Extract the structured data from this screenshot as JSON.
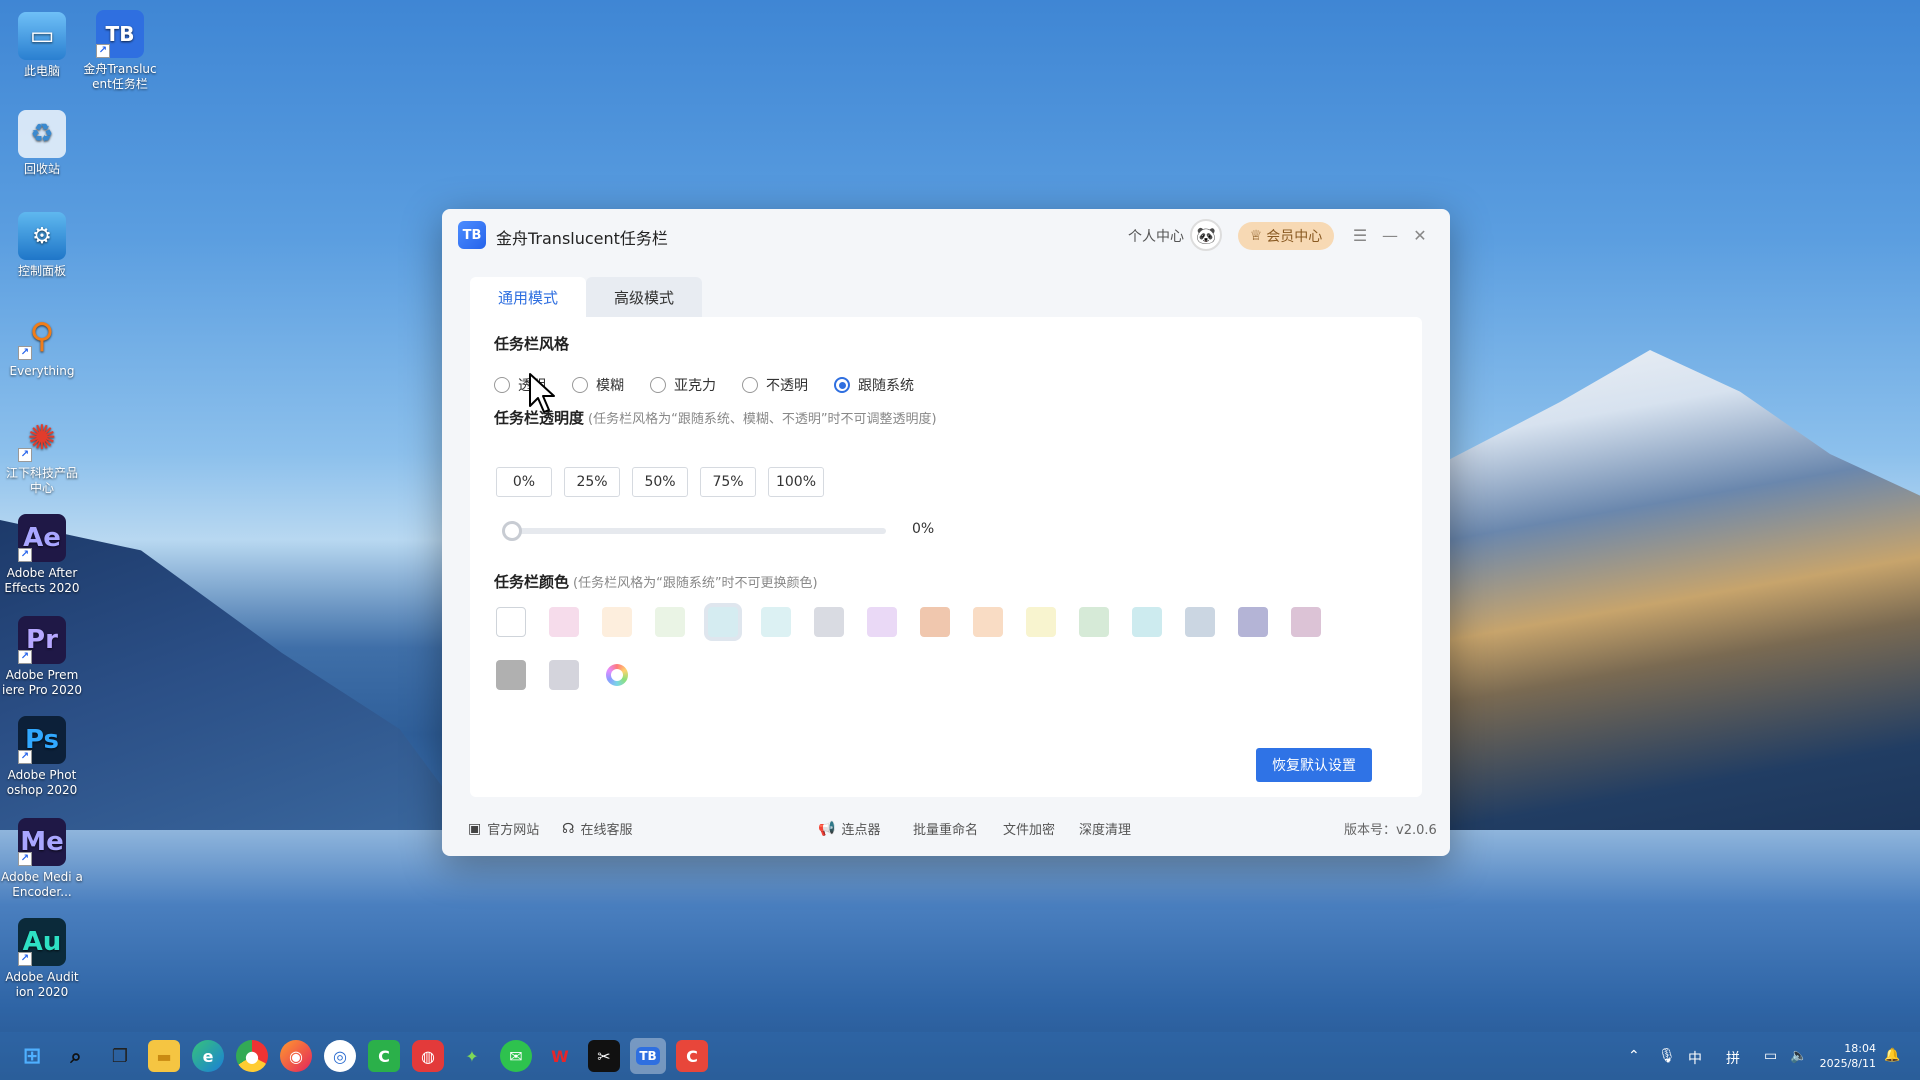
{
  "desktop": {
    "icons": [
      {
        "label": "此电脑",
        "icon": "computer-icon",
        "color": "#3b8fd8"
      },
      {
        "label": "金舟Transluc ent任务栏",
        "icon": "tb-app-icon",
        "color": "#2f6fe0"
      },
      {
        "label": "回收站",
        "icon": "recycle-bin-icon",
        "color": "#d9e6f2"
      },
      {
        "label": "控制面板",
        "icon": "control-panel-icon",
        "color": "#2e8fd8"
      },
      {
        "label": "Everything",
        "icon": "everything-search-icon",
        "color": "#f07d1a"
      },
      {
        "label": "江下科技产品 中心",
        "icon": "product-center-icon",
        "color": "#e23c2c"
      },
      {
        "label": "Adobe After Effects 2020",
        "glyph": "Ae",
        "icon": "after-effects-icon",
        "color": "#1f1846"
      },
      {
        "label": "Adobe Prem iere Pro 2020",
        "glyph": "Pr",
        "icon": "premiere-icon",
        "color": "#1f1846"
      },
      {
        "label": "Adobe Phot oshop 2020",
        "glyph": "Ps",
        "icon": "photoshop-icon",
        "color": "#0c2039"
      },
      {
        "label": "Adobe Medi a Encoder...",
        "glyph": "Me",
        "icon": "media-encoder-icon",
        "color": "#1f1846"
      },
      {
        "label": "Adobe Audit ion 2020",
        "glyph": "Au",
        "icon": "audition-icon",
        "color": "#0b2a3a"
      }
    ]
  },
  "window": {
    "logo_text": "TB",
    "title": "金舟Translucent任务栏",
    "personal_center": "个人中心",
    "vip_center": "会员中心",
    "tabs": [
      {
        "label": "通用模式",
        "active": true
      },
      {
        "label": "高级模式",
        "active": false
      }
    ],
    "style_section": {
      "title": "任务栏风格",
      "options": [
        {
          "label": "透明",
          "selected": false
        },
        {
          "label": "模糊",
          "selected": false
        },
        {
          "label": "亚克力",
          "selected": false
        },
        {
          "label": "不透明",
          "selected": false
        },
        {
          "label": "跟随系统",
          "selected": true
        }
      ]
    },
    "opacity_section": {
      "title": "任务栏透明度",
      "hint": "(任务栏风格为“跟随系统、模糊、不透明”时不可调整透明度)",
      "presets": [
        "0%",
        "25%",
        "50%",
        "75%",
        "100%"
      ],
      "slider_value": 0,
      "slider_label": "0%"
    },
    "color_section": {
      "title": "任务栏颜色",
      "hint": "(任务栏风格为“跟随系统”时不可更换颜色)",
      "colors": [
        "#ffffff",
        "#f6dceb",
        "#fdeedd",
        "#eaf4e5",
        "#d5ecf1",
        "#dcf1f3",
        "#d9dbe2",
        "#ead9f6",
        "#f0c7ae",
        "#f9dcc4",
        "#f8f4cf",
        "#d6ead7",
        "#cdebef",
        "#cbd6e2",
        "#b4b4d6",
        "#dcc3d6",
        "#b0b0b0",
        "#d4d4dc"
      ],
      "selected_index": 4
    },
    "reset_button": "恢复默认设置",
    "footer": {
      "official_site": "官方网站",
      "online_service": "在线客服",
      "clicker": "连点器",
      "batch_rename": "批量重命名",
      "file_encrypt": "文件加密",
      "deep_clean": "深度清理",
      "version": "版本号：v2.0.6"
    }
  },
  "taskbar": {
    "apps": [
      "windows-start-icon",
      "search-icon",
      "task-view-icon",
      "file-explorer-icon",
      "edge-icon",
      "chrome-icon",
      "firefox-icon",
      "cortana-icon",
      "camtasia-icon",
      "screen-recorder-icon",
      "android-icon",
      "wechat-icon",
      "wps-icon",
      "capcut-icon",
      "tb-app-icon",
      "office-app-icon"
    ],
    "tray": {
      "ime_lang": "中",
      "ime_mode": "拼"
    },
    "time": "18:04",
    "date": "2025/8/11"
  }
}
